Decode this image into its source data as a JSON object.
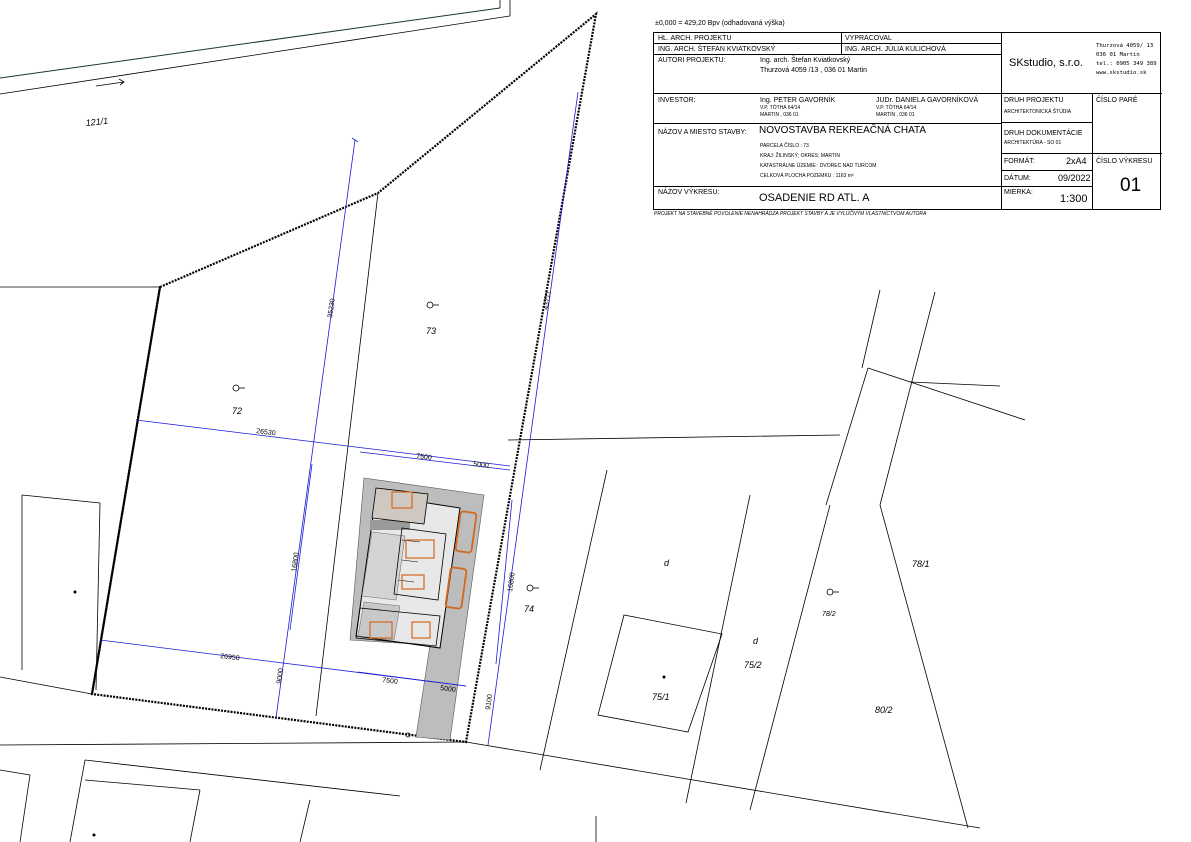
{
  "header_note": "±0,000 = 429,20 Bpv (odhadovaná výška)",
  "title_block": {
    "hl_arch_label": "HL. ARCH. PROJEKTU",
    "hl_arch_name": "ING. ARCH. ŠTEFAN KVIATKOVSKÝ",
    "vypracoval_label": "VYPRACOVAL",
    "vypracoval_name": "ING. ARCH. JÚLIA KULICHOVÁ",
    "autori_label": "AUTORI PROJEKTU:",
    "autori_name": "Ing. arch. Štefan Kviatkovský",
    "autori_address": "Thurzová 4059 /13 , 036 01 Martin",
    "company": "SKstudio, s.r.o.",
    "company_address_1": "Thurzová 4059/ 13",
    "company_address_2": "036 01 Martin",
    "company_phone": "tel.: 0905 349 389",
    "company_web": "www.skstudio.sk",
    "investor_label": "INVESTOR:",
    "investor1_name": "Ing. PETER GAVORNÍK",
    "investor1_addr1": "V.P. TÓTHA 64/14",
    "investor1_addr2": "MARTIN , 036 01",
    "investor2_name": "JUDr. DANIELA GAVORNÍKOVÁ",
    "investor2_addr1": "V.P. TÓTHA 64/14",
    "investor2_addr2": "MARTIN , 036 01",
    "druh_projektu_label": "DRUH PROJEKTU",
    "druh_projektu_value": "ARCHITEKTONICKÁ ŠTÚDIA",
    "cislo_pare_label": "ČÍSLO PARÉ",
    "nazov_stavby_label": "NÁZOV A MIESTO STAVBY:",
    "nazov_stavby_value": "NOVOSTAVBA REKREAČNÁ CHATA",
    "parcela": "PARCELA ČÍSLO : 73",
    "kraj": "KRAJ: ŽILINSKÝ; OKRES: MARTIN",
    "katastralne": "KATASTRÁLNE ÚZEMIE : DVOREC NAD TURCOM",
    "plocha": "CELKOVÁ PLOCHA POZEMKU : 1163 m²",
    "druh_dokumentacie_label": "DRUH DOKUMENTÁCIE",
    "druh_dokumentacie_value": "ARCHITEKTÚRA - SO 01",
    "format_label": "FORMÁT:",
    "format_value": "2xA4",
    "cislo_vykresu_label": "ČÍSLO VÝKRESU",
    "cislo_vykresu_value": "01",
    "datum_label": "DÁTUM:",
    "datum_value": "09/2022",
    "nazov_vykresu_label": "NÁZOV VÝKRESU:",
    "nazov_vykresu_value": "OSADENIE RD ATL. A",
    "mierka_label": "MIERKA:",
    "mierka_value": "1:300",
    "footer": "PROJEKT NA STAVEBNÉ POVOLENIE NENAHRÁDZA PROJEKT STAVBY A JE VYLÚČNÝM VLASTNÍCTVOM AUTORA"
  },
  "parcels": {
    "p121_1": "121/1",
    "p73": "73",
    "p72": "72",
    "p74": "74",
    "p75_1": "75/1",
    "p75_2": "75/2",
    "p78_1": "78/1",
    "p78_2": "78/2",
    "p80_2": "80/2",
    "d1": "d",
    "d2": "d"
  },
  "dimensions": {
    "d35230": "35230",
    "d43711": "43711",
    "d26530": "26530",
    "d7500_top": "7500",
    "d5000_top": "5000",
    "d16800_left": "16800",
    "d16800_right": "16800",
    "d26950": "26950",
    "d7500_bottom": "7500",
    "d5000_bottom": "5000",
    "d9000": "9000",
    "d9100": "9100"
  },
  "colors": {
    "dimension_line": "#1a1ad8",
    "plot_boundary": "#000000",
    "furniture": "#d2691e",
    "paving": "#b8b8b8"
  }
}
